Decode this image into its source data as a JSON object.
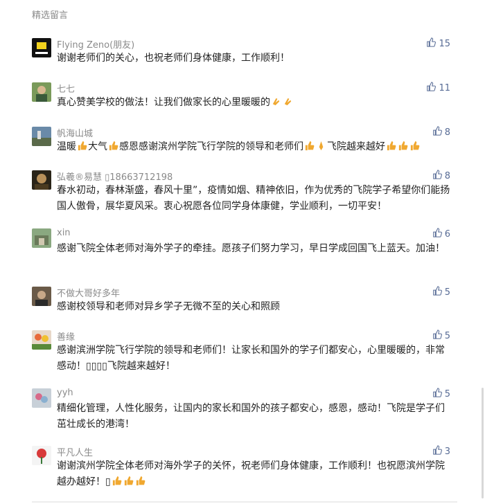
{
  "section": {
    "title": "精选留言"
  },
  "comments": [
    {
      "nick": "Flying Zeno(朋友)",
      "likes": "15",
      "avatar": "avatar-flying-zeno",
      "text": "谢谢老师们的关心，也祝老师们身体健康，工作顺利！"
    },
    {
      "nick": "七七",
      "likes": "11",
      "avatar": "avatar-qiqi",
      "text": "真心赞美学校的做法！让我们做家长的心里暖暖的"
    },
    {
      "nick": "帆海山城",
      "likes": "8",
      "avatar": "avatar-fanhaishancheng",
      "text_parts": [
        "温暖",
        "大气",
        "感恩感谢滨州学院飞行学院的领导和老师们",
        "飞院越来越好"
      ]
    },
    {
      "nick": "弘羲®易慧 ▯18663712198",
      "likes": "8",
      "avatar": "avatar-hongxi-yihui",
      "text": "春水初动，春林渐盛，春风十里”，疫情如烟、精神依旧，作为优秀的飞院学子希望你们能扬国人傲骨，展华夏风采。衷心祝愿各位同学身体康健，学业顺利，一切平安！"
    },
    {
      "nick": "xin",
      "likes": "6",
      "avatar": "avatar-xin",
      "text": "感谢飞院全体老师对海外学子的牵挂。愿孩子们努力学习，早日学成回国飞上蓝天。加油！"
    },
    {
      "nick": "不做大哥好多年",
      "likes": "5",
      "avatar": "avatar-buzuodage",
      "text": "感谢校领导和老师对异乡学子无微不至的关心和照顾"
    },
    {
      "nick": "善缘",
      "likes": "5",
      "avatar": "avatar-shanyuan",
      "text": "感谢滨洲学院飞行学院的领导和老师们！让家长和国外的学子们都安心，心里暖暖的，非常感动！▯▯▯▯飞院越来越好！"
    },
    {
      "nick": "yyh",
      "likes": "5",
      "avatar": "avatar-yyh",
      "text": "精细化管理，人性化服务，让国内的家长和国外的孩子都安心，感恩，感动！飞院是学子们茁壮成长的港湾！"
    },
    {
      "nick": "平凡人生",
      "likes": "3",
      "avatar": "avatar-pingfanrensheng",
      "text": "谢谢滨州学院全体老师对海外学子的关怀，祝老师们身体健康，工作顺利！也祝愿滨州学院越办越好！▯"
    }
  ],
  "icons": {
    "like": "thumbs-up-icon",
    "emoji_thumb": "thumbs-up-emoji",
    "emoji_clap": "clap-emoji",
    "emoji_pray": "pray-emoji"
  },
  "colors": {
    "link": "#576b95",
    "meta": "#8a8a8a",
    "text": "#222222",
    "emoji": "#f0a830"
  }
}
